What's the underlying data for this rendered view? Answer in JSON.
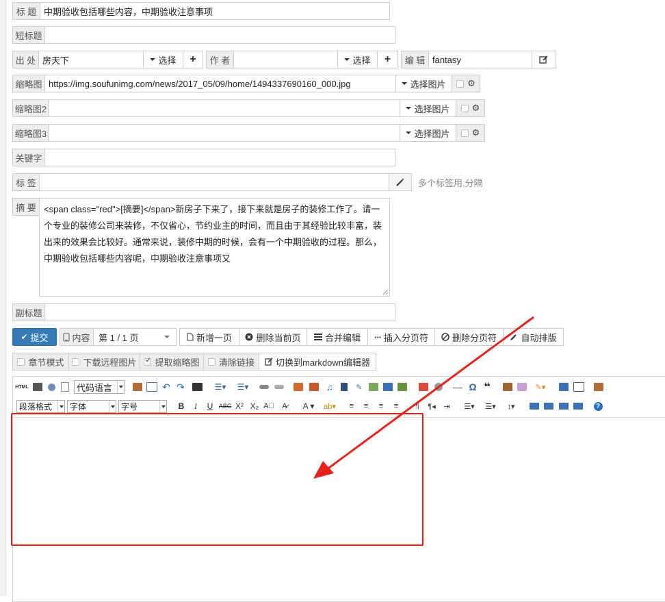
{
  "fields": {
    "title": {
      "label": "标 题",
      "value": "中期验收包括哪些内容，中期验收注意事项"
    },
    "short_title": {
      "label": "短标题",
      "value": ""
    },
    "source": {
      "label": "出 处",
      "value": "房天下",
      "select_label": "选择"
    },
    "author": {
      "label": "作 者",
      "value": "",
      "select_label": "选择"
    },
    "editor": {
      "label": "编 辑",
      "value": "fantasy"
    },
    "thumb1": {
      "label": "缩略图",
      "value": "https://img.soufunimg.com/news/2017_05/09/home/1494337690160_000.jpg",
      "select_label": "选择图片"
    },
    "thumb2": {
      "label": "缩略图2",
      "value": "",
      "select_label": "选择图片"
    },
    "thumb3": {
      "label": "缩略图3",
      "value": "",
      "select_label": "选择图片"
    },
    "keywords": {
      "label": "关键字",
      "value": ""
    },
    "tags": {
      "label": "标 签",
      "value": "",
      "hint": "多个标签用,分隔"
    },
    "summary": {
      "label": "摘 要",
      "value": "<span class=\"red\">[摘要]</span>新房子下来了，接下来就是房子的装修工作了。请一个专业的装修公司来装修，不仅省心，节约业主的时间，而且由于其经验比较丰富，装出来的效果会比较好。通常来说，装修中期的时候，会有一个中期验收的过程。那么，中期验收包括哪些内容呢，中期验收注意事项又"
    },
    "subtitle": {
      "label": "副标题",
      "value": ""
    }
  },
  "action_bar": {
    "submit": "提交",
    "content_label": "内容",
    "page_select": "第 1 / 1 页",
    "new_page": "新增一页",
    "delete_page": "删除当前页",
    "merge_edit": "合并编辑",
    "insert_break": "插入分页符",
    "delete_break": "删除分页符",
    "auto_layout": "自动排版"
  },
  "options": {
    "chapter_mode": "章节模式",
    "download_remote": "下载远程图片",
    "extract_thumb": "提取缩略图",
    "clear_links": "清除链接",
    "switch_markdown": "切换到markdown编辑器"
  },
  "editor_toolbar": {
    "code_lang": "代码语言",
    "paragraph": "段落格式",
    "font_family": "字体",
    "font_size": "字号",
    "html_icon_text": "HTML"
  },
  "colors": {
    "accent": "#337ab7",
    "annotation": "#e8221b"
  }
}
